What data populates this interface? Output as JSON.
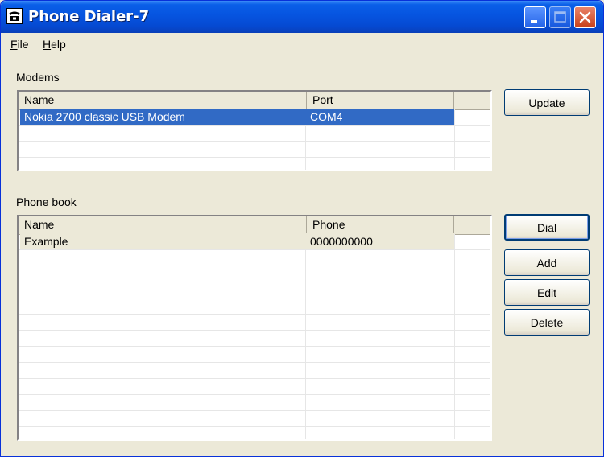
{
  "window": {
    "title": "Phone Dialer-7",
    "icon": "telephone-icon"
  },
  "menu": {
    "file": "File",
    "help": "Help"
  },
  "modems": {
    "label": "Modems",
    "columns": [
      "Name",
      "Port"
    ],
    "rows": [
      {
        "name": "Nokia 2700 classic USB Modem",
        "port": "COM4",
        "selected": true
      }
    ],
    "update_label": "Update"
  },
  "phonebook": {
    "label": "Phone book",
    "columns": [
      "Name",
      "Phone"
    ],
    "rows": [
      {
        "name": "Example",
        "phone": "0000000000",
        "selected": true
      }
    ],
    "dial_label": "Dial",
    "add_label": "Add",
    "edit_label": "Edit",
    "delete_label": "Delete"
  },
  "colors": {
    "selection": "#316ac5",
    "inactive_selection": "#ece9d8",
    "titlebar": "#0654e0"
  }
}
